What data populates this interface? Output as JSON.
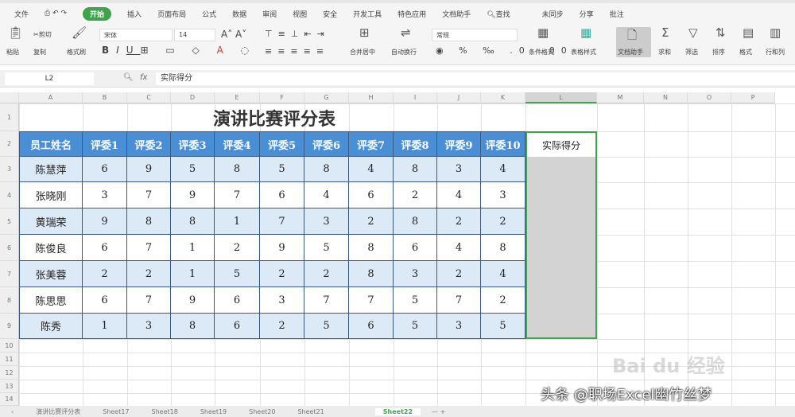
{
  "menu": {
    "file": "文件",
    "tabs": [
      "开始",
      "插入",
      "页面布局",
      "公式",
      "数据",
      "审阅",
      "视图",
      "安全",
      "开发工具",
      "特色应用",
      "文档助手"
    ],
    "search": "查找",
    "right": [
      "未同步",
      "分享",
      "批注"
    ]
  },
  "ribbon": {
    "paste": "粘贴",
    "cut": "剪切",
    "copy": "复制",
    "format_painter": "格式刷",
    "font": "宋体",
    "size": "14",
    "merge": "合并居中",
    "wrap": "自动换行",
    "number_format": "常规",
    "cond_format": "条件格式",
    "table_style": "表格样式",
    "doc_helper": "文档助手",
    "sum": "求和",
    "filter": "筛选",
    "sort": "排序",
    "format": "格式",
    "rowcol": "行和列"
  },
  "formula_bar": {
    "cell_ref": "L2",
    "fx": "fx",
    "content": "实际得分"
  },
  "columns": [
    "A",
    "B",
    "C",
    "D",
    "E",
    "F",
    "G",
    "H",
    "I",
    "J",
    "K",
    "L",
    "M",
    "N",
    "O",
    "P"
  ],
  "rows": [
    "1",
    "2",
    "3",
    "4",
    "5",
    "6",
    "7",
    "8",
    "9",
    "10",
    "11",
    "12",
    "13",
    "14"
  ],
  "sheet": {
    "title": "演讲比赛评分表",
    "headers": [
      "员工姓名",
      "评委1",
      "评委2",
      "评委3",
      "评委4",
      "评委5",
      "评委6",
      "评委7",
      "评委8",
      "评委9",
      "评委10",
      "实际得分"
    ],
    "data": [
      [
        "陈慧萍",
        "6",
        "9",
        "5",
        "8",
        "5",
        "8",
        "4",
        "8",
        "3",
        "4"
      ],
      [
        "张晓刚",
        "3",
        "7",
        "9",
        "7",
        "6",
        "4",
        "6",
        "2",
        "4",
        "3"
      ],
      [
        "黄瑞荣",
        "9",
        "8",
        "8",
        "1",
        "7",
        "3",
        "2",
        "8",
        "2",
        "2"
      ],
      [
        "陈俊良",
        "6",
        "7",
        "1",
        "2",
        "9",
        "5",
        "8",
        "6",
        "4",
        "8"
      ],
      [
        "张美蓉",
        "2",
        "2",
        "1",
        "5",
        "2",
        "2",
        "8",
        "3",
        "2",
        "4"
      ],
      [
        "陈思思",
        "6",
        "7",
        "9",
        "6",
        "3",
        "7",
        "7",
        "5",
        "7",
        "2"
      ],
      [
        "陈秀",
        "1",
        "3",
        "8",
        "6",
        "2",
        "5",
        "6",
        "5",
        "3",
        "5"
      ]
    ]
  },
  "sheet_tabs": [
    "演讲比赛评分表",
    "Sheet17",
    "Sheet18",
    "Sheet19",
    "Sheet20",
    "Sheet21",
    "Sheet22"
  ],
  "active_sheet": "Sheet22",
  "watermark": "头条 @职场Excel幽竹丝梦",
  "baidu": "Bai du 经验",
  "colors": {
    "header": "#4a8fd6",
    "odd": "#dce9f6",
    "accent": "#3fa34d"
  }
}
